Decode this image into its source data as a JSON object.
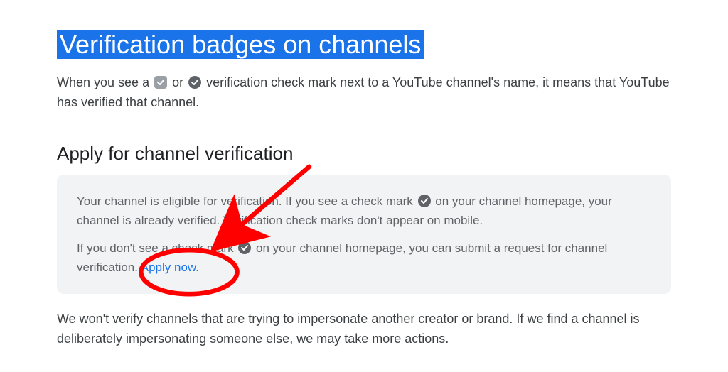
{
  "title": "Verification badges on channels",
  "intro": {
    "seg1": "When you see a ",
    "seg2": " or ",
    "seg3": " verification check mark next to a YouTube channel's name, it means that YouTube has verified that channel."
  },
  "subtitle": "Apply for channel verification",
  "panel": {
    "p1a": "Your channel is eligible for verification. If you see a check mark ",
    "p1b": " on your channel homepage, your channel is already verified. Verification check marks don't appear on mobile.",
    "p2a": "If you don't see a check mark ",
    "p2b": " on your channel homepage, you can submit a request for channel verification. ",
    "apply": "Apply now",
    "dot": "."
  },
  "footer": "We won't verify channels that are trying to impersonate another creator or brand. If we find a channel is deliberately impersonating someone else, we may take more actions."
}
